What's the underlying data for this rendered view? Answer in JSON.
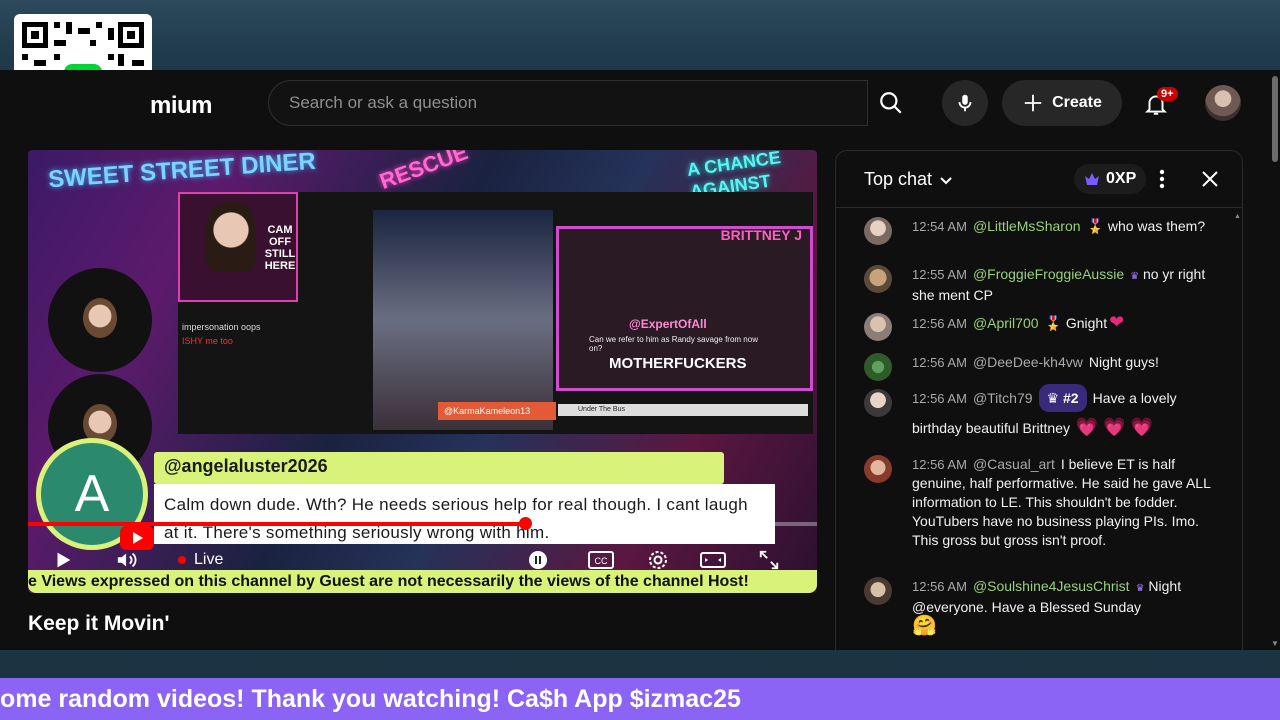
{
  "header": {
    "brand_fragment": "mium",
    "search_placeholder": "Search or ask a question",
    "create_label": "Create",
    "notification_count": "9+"
  },
  "overlay": {
    "qr_icon": "cash-app-qr-icon"
  },
  "video": {
    "title": "Keep it Movin'",
    "caption_author": "@angelaluster2026",
    "caption_text": "Calm down dude. Wth? He needs serious help for real though. I cant laugh at it. There's something seriously wrong with him.",
    "caption_avatar_letter": "A",
    "live_label": "Live",
    "ticker_text": "e Views expressed on this channel by Guest are not necessarily the views of the channel Host!",
    "progress": 0.63,
    "inner": {
      "neon_left": "SWEET STREET DINER",
      "neon_mid": "RESCUE",
      "neon_right": "A CHANCE AGAINST",
      "cam_text": "CAM OFF STILL HERE",
      "right_title": "BRITTNEY J",
      "right_handle": "@ExpertOfAll",
      "right_question": "Can we refer to him as Randy savage from now on?",
      "right_big": "MOTHERFUCKERS",
      "karma": "@KarmaKameleon13",
      "under_bus": "Under The Bus",
      "inner_chat": [
        "impersonation oops",
        "ISHY me too"
      ]
    }
  },
  "chat": {
    "title": "Top chat",
    "xp": "0XP",
    "messages": [
      {
        "time": "12:54 AM",
        "author": "@LittleMsSharon",
        "text": "who was them?"
      },
      {
        "time": "12:55 AM",
        "author": "@FroggieFroggieAussie",
        "text": "no yr right she ment CP"
      },
      {
        "time": "12:56 AM",
        "author": "@April700",
        "text": "Gnight"
      },
      {
        "time": "12:56 AM",
        "author": "@DeeDee-kh4vw",
        "text": "Night guys!"
      },
      {
        "time": "12:56 AM",
        "author": "@Titch79",
        "rank": "#2",
        "text": "Have a lovely birthday beautiful Brittney"
      },
      {
        "time": "12:56 AM",
        "author": "@Casual_art",
        "text": "I believe ET is half genuine, half performative. He said he gave ALL information to LE. This shouldn't be fodder. YouTubers have no business playing PIs. Imo. This gross but gross isn't proof."
      },
      {
        "time": "12:56 AM",
        "author": "@Soulshine4JesusChrist",
        "text": "Night @everyone. Have a Blessed Sunday"
      }
    ]
  },
  "marquee": {
    "text": "ome random videos! Thank you watching! Ca$h App $izmac25"
  },
  "colors": {
    "accent_red": "#ff0000",
    "caption_green": "#d8f27a",
    "marquee_purple": "#8b63f5",
    "author_green": "#9ad07a"
  }
}
